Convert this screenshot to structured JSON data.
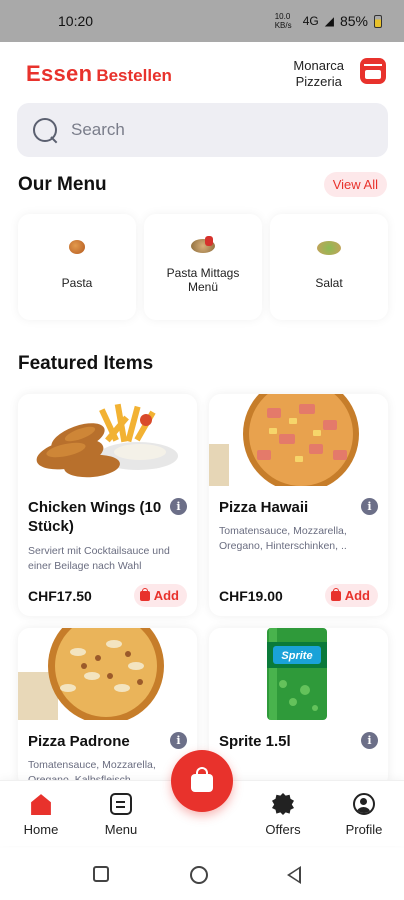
{
  "status_bar": {
    "time": "10:20",
    "data_speed": "10.0 KB/s",
    "network": "4G",
    "battery": "85%"
  },
  "header": {
    "logo_primary": "Essen",
    "logo_secondary": "Bestellen",
    "store_name_line1": "Monarca",
    "store_name_line2": "Pizzeria",
    "store_icon": "store-icon"
  },
  "search": {
    "placeholder": "Search",
    "value": ""
  },
  "menu_section": {
    "title": "Our Menu",
    "view_all_label": "View All",
    "categories": [
      {
        "label": "Pasta",
        "icon": "pasta-image"
      },
      {
        "label": "Pasta Mittags Menü",
        "icon": "pasta-mittag-image"
      },
      {
        "label": "Salat",
        "icon": "salat-image"
      }
    ]
  },
  "featured_section": {
    "title": "Featured Items",
    "items": [
      {
        "name": "Chicken Wings (10 Stück)",
        "description": "Serviert mit Cocktailsauce und einer Beilage nach Wahl",
        "price": "CHF17.50",
        "add_label": "Add"
      },
      {
        "name": "Pizza Hawaii",
        "description": "Tomatensauce, Mozzarella, Oregano, Hinterschinken, ..",
        "price": "CHF19.00",
        "add_label": "Add"
      },
      {
        "name": "Pizza Padrone",
        "description": "Tomatensauce, Mozzarella, Oregano, Kalbsfleisch",
        "price": "",
        "add_label": ""
      },
      {
        "name": "Sprite 1.5l",
        "description": "",
        "price": "",
        "add_label": ""
      }
    ]
  },
  "bottom_nav": {
    "items": [
      {
        "label": "Home",
        "active": true
      },
      {
        "label": "Menu",
        "active": false
      },
      {
        "label": "Offers",
        "active": false
      },
      {
        "label": "Profile",
        "active": false
      }
    ],
    "cart_fab_icon": "shopping-bag-icon"
  },
  "colors": {
    "accent": "#e8322c",
    "accent_light": "#fde8ea",
    "search_bg": "#eeeef3",
    "muted_text": "#6a6d80"
  }
}
